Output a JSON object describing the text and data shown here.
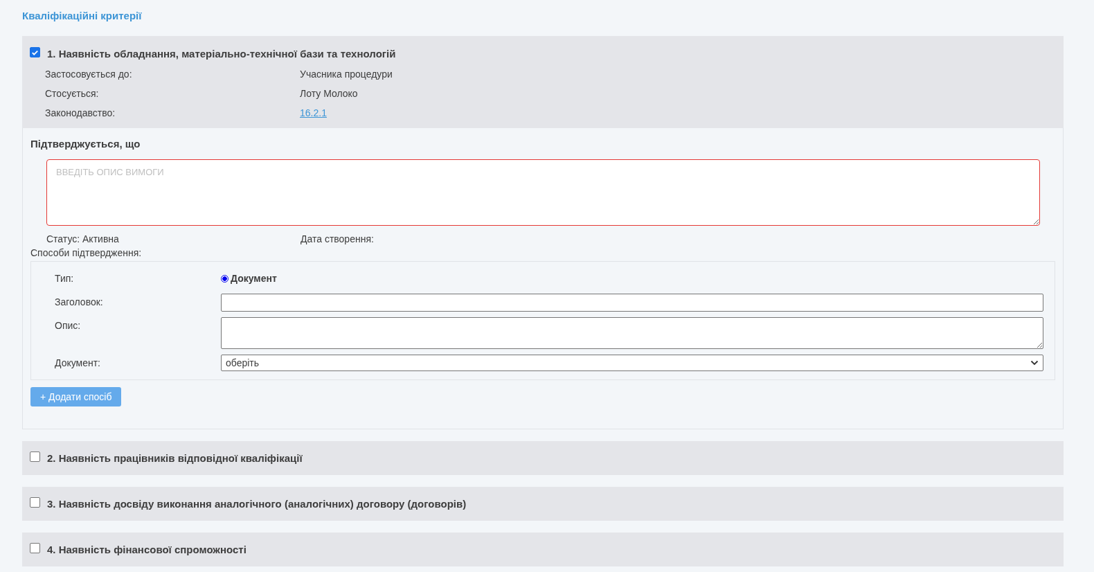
{
  "title": "Кваліфікаційні критерії",
  "criteria": [
    {
      "title": "1. Наявність обладнання, матеріально-технічної бази та технологій",
      "checked": true,
      "fields": [
        {
          "label": "Застосовується до:",
          "value": "Учасника процедури",
          "kind": "text"
        },
        {
          "label": "Стосується:",
          "value": "Лоту Молоко",
          "kind": "text"
        },
        {
          "label": "Законодавство:",
          "value": "16.2.1",
          "kind": "link"
        }
      ],
      "body": {
        "heading": "Підтверджується, що",
        "requirement": {
          "placeholder": "ВВЕДІТЬ ОПИС ВИМОГИ",
          "error": true
        },
        "status": "Статус: Активна",
        "created": "Дата створення:",
        "methods_label": "Способи підтвердження:",
        "method": {
          "type_label": "Тип:",
          "types": [
            {
              "label": "Документ",
              "selected": true
            }
          ],
          "title_label": "Заголовок:",
          "description_label": "Опис:",
          "document_label": "Документ:",
          "document_value": "оберіть"
        },
        "add_button": "+ Додати спосіб"
      }
    },
    {
      "title": "2. Наявність працівників відповідної кваліфікації",
      "checked": false
    },
    {
      "title": "3. Наявність досвіду виконання аналогічного (аналогічних) договору (договорів)",
      "checked": false
    },
    {
      "title": "4. Наявність фінансової спроможності",
      "checked": false
    }
  ]
}
